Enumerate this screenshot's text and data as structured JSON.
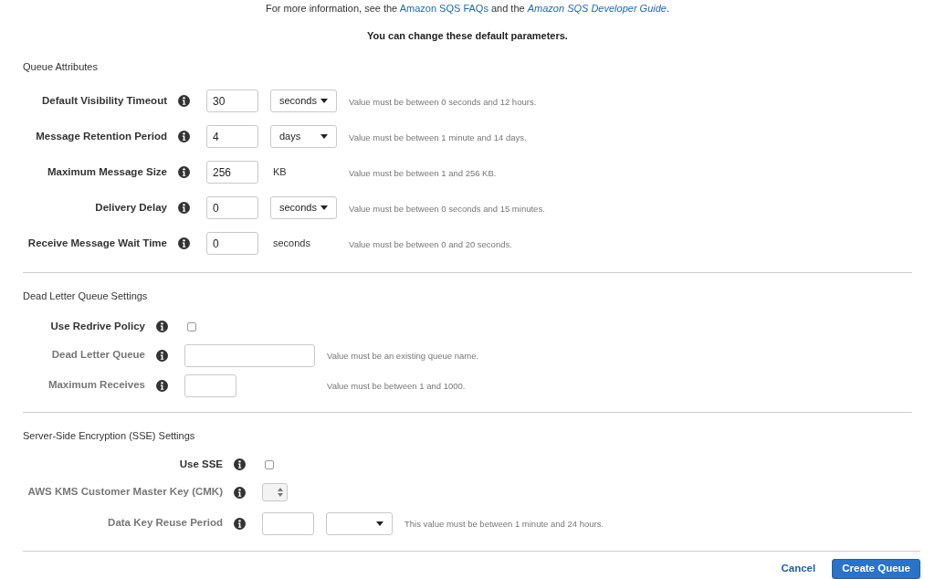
{
  "intro": [
    {
      "kind": "text",
      "text": "For more information, see the "
    },
    {
      "kind": "link",
      "text": "Amazon SQS FAQs"
    },
    {
      "kind": "text",
      "text": " and the "
    },
    {
      "kind": "link",
      "text": "*Amazon SQS Developer Guide*"
    },
    {
      "kind": "text",
      "text": "."
    }
  ],
  "notice": "You can change these default parameters.",
  "sections": [
    {
      "title": "Queue Attributes",
      "fields": [
        {
          "kind": "number_select",
          "label": "Default Visibility Timeout",
          "value": "30",
          "unit": "seconds",
          "hint": "Value must be between 0 seconds and 12 hours.",
          "disabled": false
        },
        {
          "kind": "number_select",
          "label": "Message Retention Period",
          "value": "4",
          "unit": "days",
          "hint": "Value must be between 1 minute and 14 days.",
          "disabled": false
        },
        {
          "kind": "number_unit",
          "label": "Maximum Message Size",
          "value": "256",
          "unit": "KB",
          "hint": "Value must be between 1 and 256 KB.",
          "disabled": false
        },
        {
          "kind": "number_select",
          "label": "Delivery Delay",
          "value": "0",
          "unit": "seconds",
          "hint": "Value must be between 0 seconds and 15 minutes.",
          "disabled": false
        },
        {
          "kind": "number_unit",
          "label": "Receive Message Wait Time",
          "value": "0",
          "unit": "seconds",
          "hint": "Value must be between 0 and 20 seconds.",
          "disabled": false
        }
      ]
    },
    {
      "title": "Dead Letter Queue Settings",
      "fields": [
        {
          "kind": "checkbox",
          "label": "Use Redrive Policy",
          "checked": false,
          "disabled": false
        },
        {
          "kind": "text",
          "label": "Dead Letter Queue",
          "hint": "Value must be an existing queue name.",
          "disabled": true
        },
        {
          "kind": "number",
          "label": "Maximum Receives",
          "hint": "Value must be between 1 and 1000.",
          "disabled": true
        }
      ]
    },
    {
      "title": "Server-Side Encryption (SSE) Settings",
      "fields": [
        {
          "kind": "checkbox",
          "label": "Use SSE",
          "checked": false,
          "disabled": false
        },
        {
          "kind": "spinner",
          "label": "AWS KMS Customer Master Key (CMK)",
          "disabled": true
        },
        {
          "kind": "number_select",
          "label": "Data Key Reuse Period",
          "hint": "This value must be between 1 minute and 24 hours.",
          "disabled": true
        }
      ]
    }
  ],
  "buttons": [
    {
      "kind": "link",
      "label": "Cancel"
    },
    {
      "kind": "primary",
      "label": "Create Queue"
    }
  ]
}
